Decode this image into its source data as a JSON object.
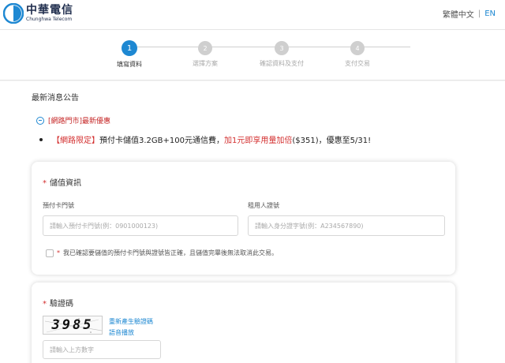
{
  "header": {
    "logo_cn": "中華電信",
    "logo_en": "Chunghwa Telecom",
    "lang_current": "繁體中文",
    "lang_separator": "|",
    "lang_other": "EN"
  },
  "steps": {
    "items": [
      {
        "num": "1",
        "label": "填寫資料",
        "active": true
      },
      {
        "num": "2",
        "label": "選擇方案",
        "active": false
      },
      {
        "num": "3",
        "label": "確認資料及支付",
        "active": false
      },
      {
        "num": "4",
        "label": "支付交易",
        "active": false
      }
    ]
  },
  "news": {
    "title": "最新消息公告",
    "toggle_label": "[網路門市]最新優惠",
    "item": {
      "tag": "【網路限定】",
      "text1": "預付卡儲值3.2GB+100元通信費，",
      "highlight": "加1元即享用量加倍",
      "text2": "($351)，優惠至5/31!"
    }
  },
  "storedvalue": {
    "title": "儲值資訊",
    "card_label": "預付卡門號",
    "card_placeholder": "請輸入預付卡門號(例：0901000123)",
    "id_label": "租用人證號",
    "id_placeholder": "請輸入身分證字號(例：A234567890)",
    "agree_text": "我已確認要儲值的預付卡門號與證號皆正確，且儲值完畢後無法取消此交易。"
  },
  "verify": {
    "title": "驗證碼",
    "captcha_text": "3985",
    "regen_label": "重新產生驗證碼",
    "audio_label": "語音播放",
    "input_placeholder": "請輸入上方數字"
  },
  "colors": {
    "accent": "#1e88d2",
    "required": "#d32f2f",
    "brand_navy": "#1f2d4d"
  }
}
